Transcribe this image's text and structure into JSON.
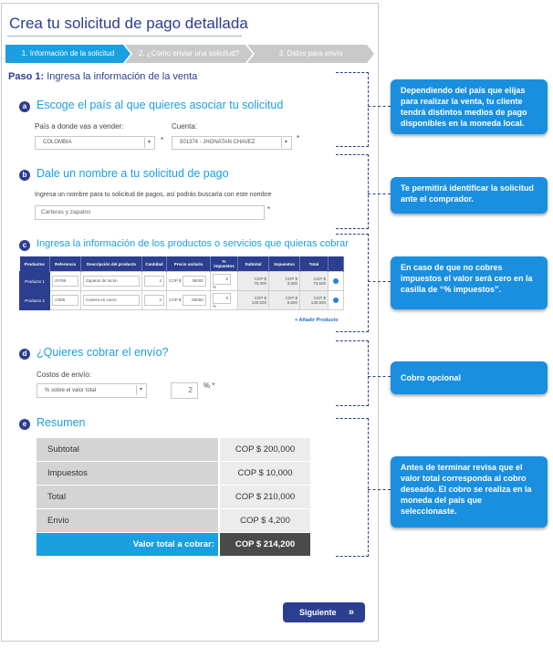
{
  "page": {
    "title": "Crea tu solicitud de pago detallada"
  },
  "steps": [
    {
      "label": "1. Información de la solicitud"
    },
    {
      "label": "2. ¿Cómo enviar una solicitud?"
    },
    {
      "label": "3. Datos para envío"
    }
  ],
  "paso": {
    "prefix": "Paso 1:",
    "text": "Ingresa la información de la venta"
  },
  "section_a": {
    "badge": "a",
    "title": "Escoge el país al que quieres asociar tu solicitud",
    "country_label": "País a donde vas a vender:",
    "country_value": "COLOMBIA",
    "account_label": "Cuenta:",
    "account_value": "501374 - JHONATAN CHAVEZ",
    "required": "*"
  },
  "section_b": {
    "badge": "b",
    "title": "Dale un nombre a tu solicitud de pago",
    "hint": "Ingresa un nombre para tu solicitud de pagos, así podrás buscarla con este nombre",
    "name_value": "Carteras y zapatos",
    "required": "*"
  },
  "section_c": {
    "badge": "c",
    "title": "Ingresa la información de los productos o servicios que quieras cobrar",
    "headers": [
      "Productos",
      "Referencia",
      "Descripción del producto",
      "Cantidad",
      "Precio unitario",
      "% impuestos",
      "Subtotal",
      "Impuestos",
      "Total",
      ""
    ],
    "rows": [
      {
        "product": "Producto 1",
        "ref": "zh789",
        "desc": "Zapatos de tacón",
        "qty": "2",
        "currency": "COP $",
        "price": "35000",
        "tax": "5",
        "pct": "%",
        "subtotal_cur": "COP $",
        "subtotal": "70,000",
        "taxes_cur": "COP $",
        "taxes": "3,500",
        "total_cur": "COP $",
        "total": "73,500"
      },
      {
        "product": "Producto 2",
        "ref": "cr586",
        "desc": "Cartera en cuero",
        "qty": "2",
        "currency": "COP $",
        "price": "65000",
        "tax": "5",
        "pct": "%",
        "subtotal_cur": "COP $",
        "subtotal": "130,000",
        "taxes_cur": "COP $",
        "taxes": "6,500",
        "total_cur": "COP $",
        "total": "136,500"
      }
    ],
    "add_link": "+ Añadir Producto"
  },
  "section_d": {
    "badge": "d",
    "title": "¿Quieres cobrar el envío?",
    "label": "Costos de envío:",
    "select_value": "% sobre el valor total",
    "pct_value": "2",
    "pct_suffix": "% *"
  },
  "section_e": {
    "badge": "e",
    "title": "Resumen",
    "rows": [
      {
        "label": "Subtotal",
        "value": "COP $ 200,000"
      },
      {
        "label": "Impuestos",
        "value": "COP $ 10,000"
      },
      {
        "label": "Total",
        "value": "COP $ 210,000"
      },
      {
        "label": "Envio",
        "value": "COP $ 4,200"
      }
    ],
    "grand_total_label": "Valor total a cobrar:",
    "grand_total_value": "COP $ 214,200"
  },
  "next_button": {
    "label": "Siguiente",
    "icon": "»"
  },
  "callouts": [
    {
      "text": "Dependiendo del país que elijas para realizar la venta,  tu cliente tendrá distintos medios de pago disponibles en la moneda local."
    },
    {
      "text": "Te permitirá identificar la solicitud ante el comprador."
    },
    {
      "text": "En caso de que no cobres impuestos el valor será cero en la casilla de “% impuestos”."
    },
    {
      "text": "Cobro opcional"
    },
    {
      "text": "Antes de terminar revisa que el valor total corresponda al cobro deseado. El cobro se realiza en la moneda del país que seleccionaste."
    }
  ],
  "colors": {
    "brand_navy": "#2b3e8f",
    "accent_blue": "#1a9fe0",
    "callout_blue": "#1a8fe0",
    "total_dark": "#4a4a4a"
  }
}
